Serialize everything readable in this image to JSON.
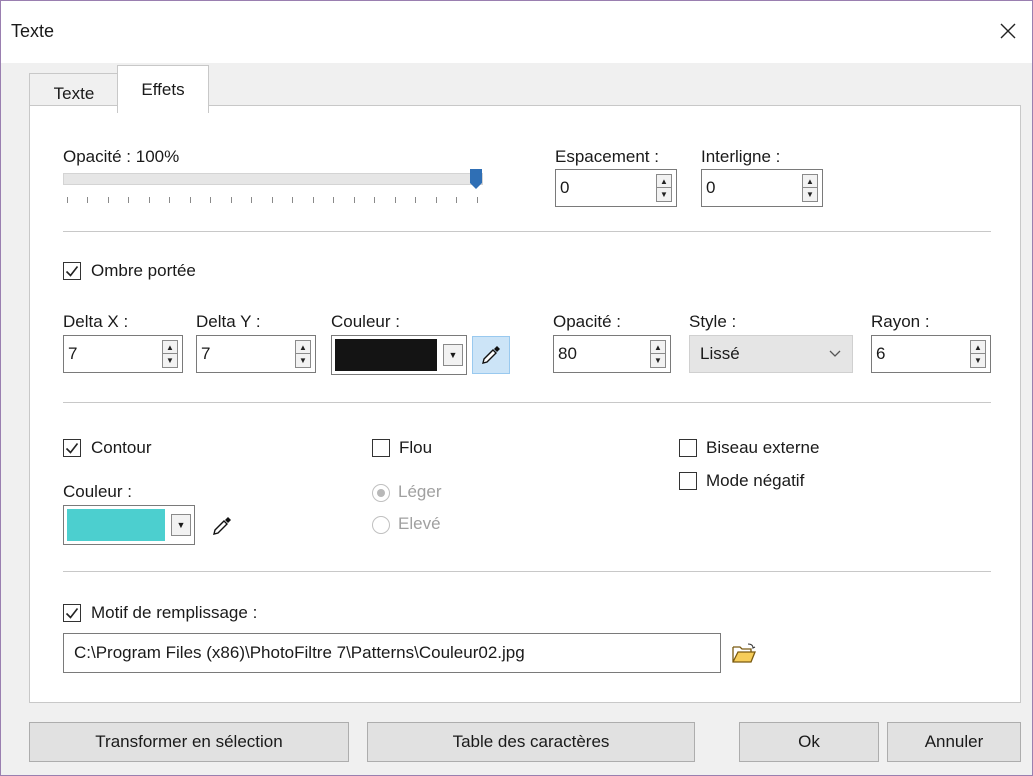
{
  "window": {
    "title": "Texte",
    "close_icon": "close-icon"
  },
  "tabs": [
    {
      "label": "Texte"
    },
    {
      "label": "Effets",
      "active": true
    }
  ],
  "opacity": {
    "label": "Opacité : 100%",
    "value": 100
  },
  "spacing": {
    "label": "Espacement :",
    "value": "0"
  },
  "line_spacing": {
    "label": "Interligne :",
    "value": "0"
  },
  "shadow": {
    "checkbox_label": "Ombre portée",
    "checked": true,
    "delta_x_label": "Delta X :",
    "delta_x": "7",
    "delta_y_label": "Delta Y :",
    "delta_y": "7",
    "color_label": "Couleur :",
    "color": "#141414",
    "opacity_label": "Opacité :",
    "opacity": "80",
    "style_label": "Style :",
    "style": "Lissé",
    "radius_label": "Rayon :",
    "radius": "6"
  },
  "outline": {
    "checkbox_label": "Contour",
    "checked": true,
    "color_label": "Couleur :",
    "color": "#4ccfcf"
  },
  "blur": {
    "checkbox_label": "Flou",
    "checked": false,
    "option_light": "Léger",
    "option_high": "Elevé"
  },
  "bevel": {
    "label": "Biseau externe",
    "checked": false
  },
  "negative": {
    "label": "Mode négatif",
    "checked": false
  },
  "fill_pattern": {
    "checkbox_label": "Motif de remplissage :",
    "checked": true,
    "path": "C:\\Program Files (x86)\\PhotoFiltre 7\\Patterns\\Couleur02.jpg"
  },
  "buttons": {
    "transform": "Transformer en sélection",
    "charmap": "Table des caractères",
    "ok": "Ok",
    "cancel": "Annuler"
  },
  "colors": {
    "accent": "#1e6fbf",
    "slider_thumb": "#2f6fb5"
  }
}
